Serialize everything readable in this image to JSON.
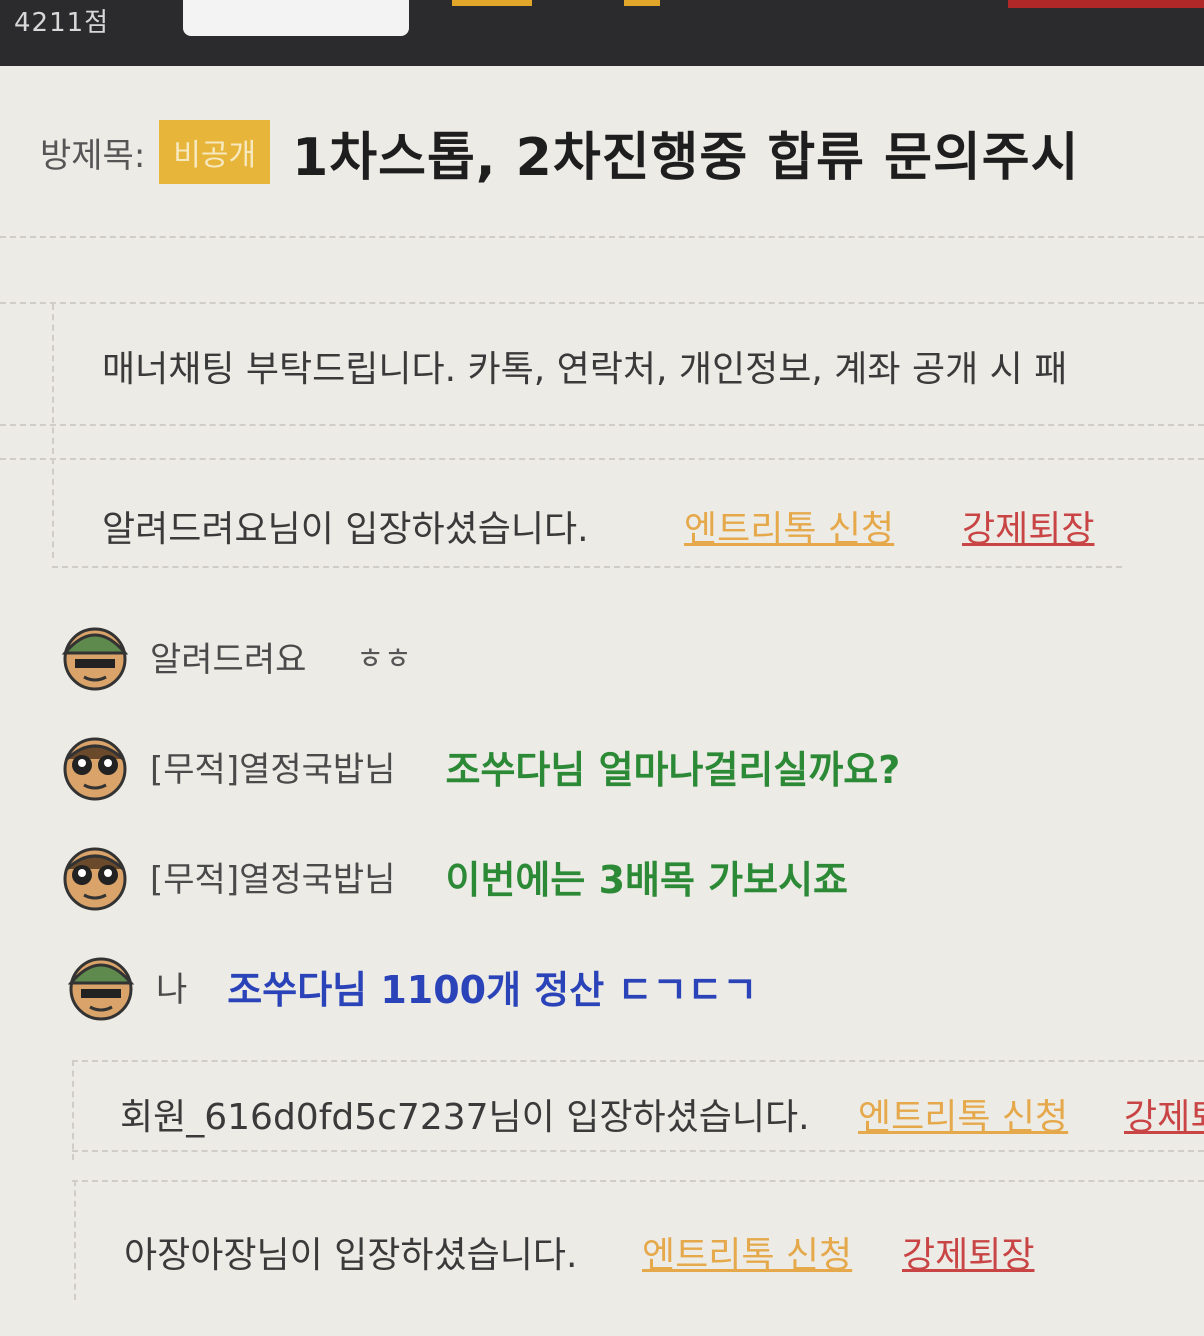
{
  "topbar": {
    "points": "4211점"
  },
  "room": {
    "title_label": "방제목:",
    "badge": "비공개",
    "title": "1차스톱, 2차진행중 합류 문의주시"
  },
  "notice": {
    "text": "매너채팅 부탁드립니다. 카톡, 연락처, 개인정보, 계좌 공개 시 패"
  },
  "entries": [
    {
      "text": "알려드려요님이 입장하셨습니다.",
      "apply_label": "엔트리톡 신청",
      "kick_label": "강제퇴장"
    },
    {
      "text": "회원_616d0fd5c7237님이 입장하셨습니다.",
      "apply_label": "엔트리톡 신청",
      "kick_label": "강제퇴"
    },
    {
      "text": "아장아장님이 입장하셨습니다.",
      "apply_label": "엔트리톡 신청",
      "kick_label": "강제퇴장"
    }
  ],
  "messages": [
    {
      "nick": "알려드려요",
      "text": "ㅎㅎ",
      "avatar": "soldier-helmet-icon"
    },
    {
      "nick": "[무적]열정국밥님",
      "text": "조쑤다님 얼마나걸리실까요?",
      "avatar": "goggles-face-icon"
    },
    {
      "nick": "[무적]열정국밥님",
      "text": "이번에는 3배목 가보시죠",
      "avatar": "goggles-face-icon"
    },
    {
      "nick": "나",
      "text": "조쑤다님 1100개 정산 ㄷㄱㄷㄱ",
      "avatar": "soldier-helmet-icon"
    }
  ],
  "colors": {
    "badge": "#e7b53a",
    "green_text": "#2c8a37",
    "blue_text": "#2a43b8",
    "apply_link": "#e5a84a",
    "kick_link": "#c94545"
  }
}
